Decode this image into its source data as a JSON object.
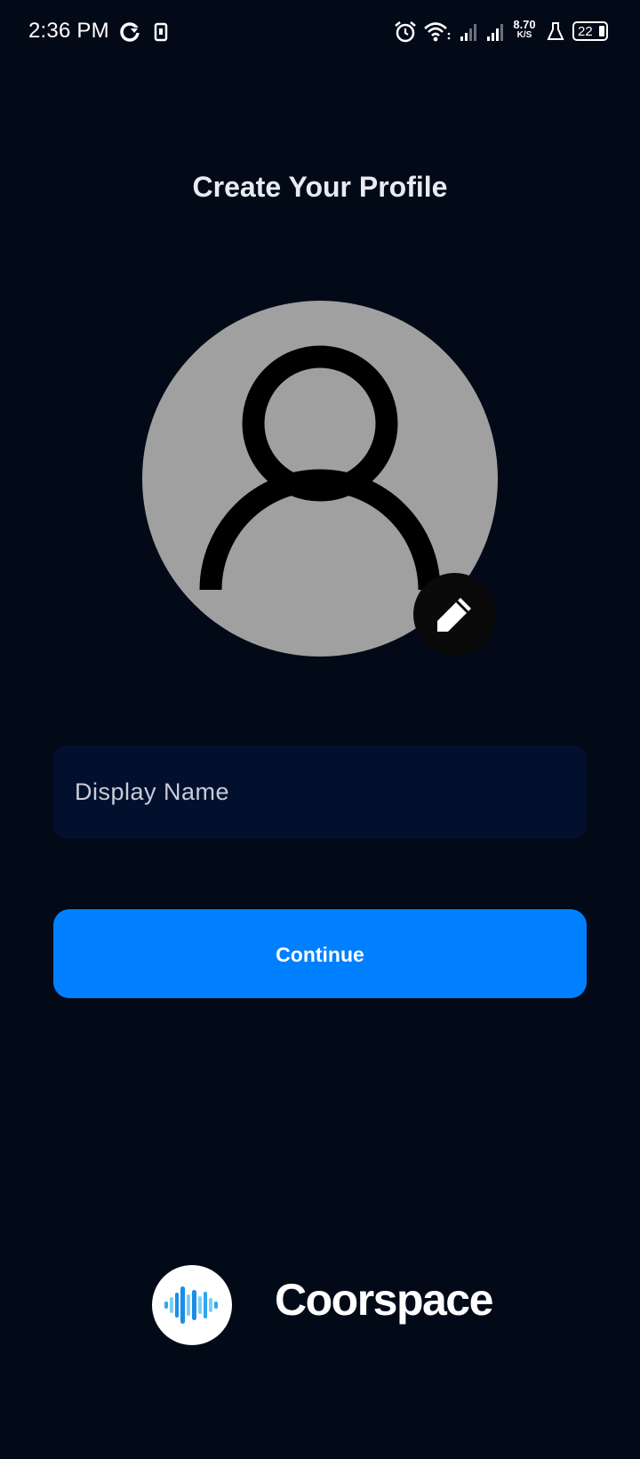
{
  "status_bar": {
    "time": "2:36 PM",
    "net_speed_value": "8.70",
    "net_speed_unit": "K/S",
    "battery_level": "22",
    "icons": [
      "sync-icon",
      "sim-card-icon",
      "alarm-icon",
      "wifi-icon",
      "signal-1-icon",
      "signal-2-icon",
      "flask-icon",
      "battery-icon"
    ]
  },
  "header": {
    "title": "Create Your Profile"
  },
  "avatar": {
    "placeholder_icon": "person-outline-icon",
    "edit_icon": "pencil-icon"
  },
  "form": {
    "display_name_placeholder": "Display Name",
    "display_name_value": ""
  },
  "actions": {
    "continue_label": "Continue"
  },
  "brand": {
    "name": "Coorspace",
    "logo_icon": "sound-wave-logo"
  },
  "colors": {
    "background": "#020a18",
    "field_background": "#02102e",
    "primary": "#0080ff",
    "avatar_background": "#a0a0a0"
  }
}
